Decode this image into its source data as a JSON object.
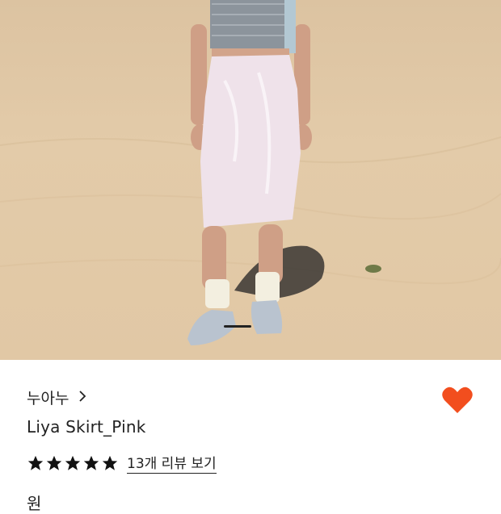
{
  "product": {
    "image_alt": "Model wearing pink jacquard midi skirt standing on sand dune",
    "brand": "누아누",
    "title": "Liya Skirt_Pink",
    "rating_stars": 5,
    "review_link": "13개 리뷰 보기",
    "price_partial": "원"
  },
  "colors": {
    "heart": "#f24e1e",
    "text": "#222222",
    "sand": "#e1c8a5"
  },
  "icons": {
    "brand_chevron": "chevron-right-icon",
    "favorite": "heart-icon",
    "rating": "star-icon"
  }
}
